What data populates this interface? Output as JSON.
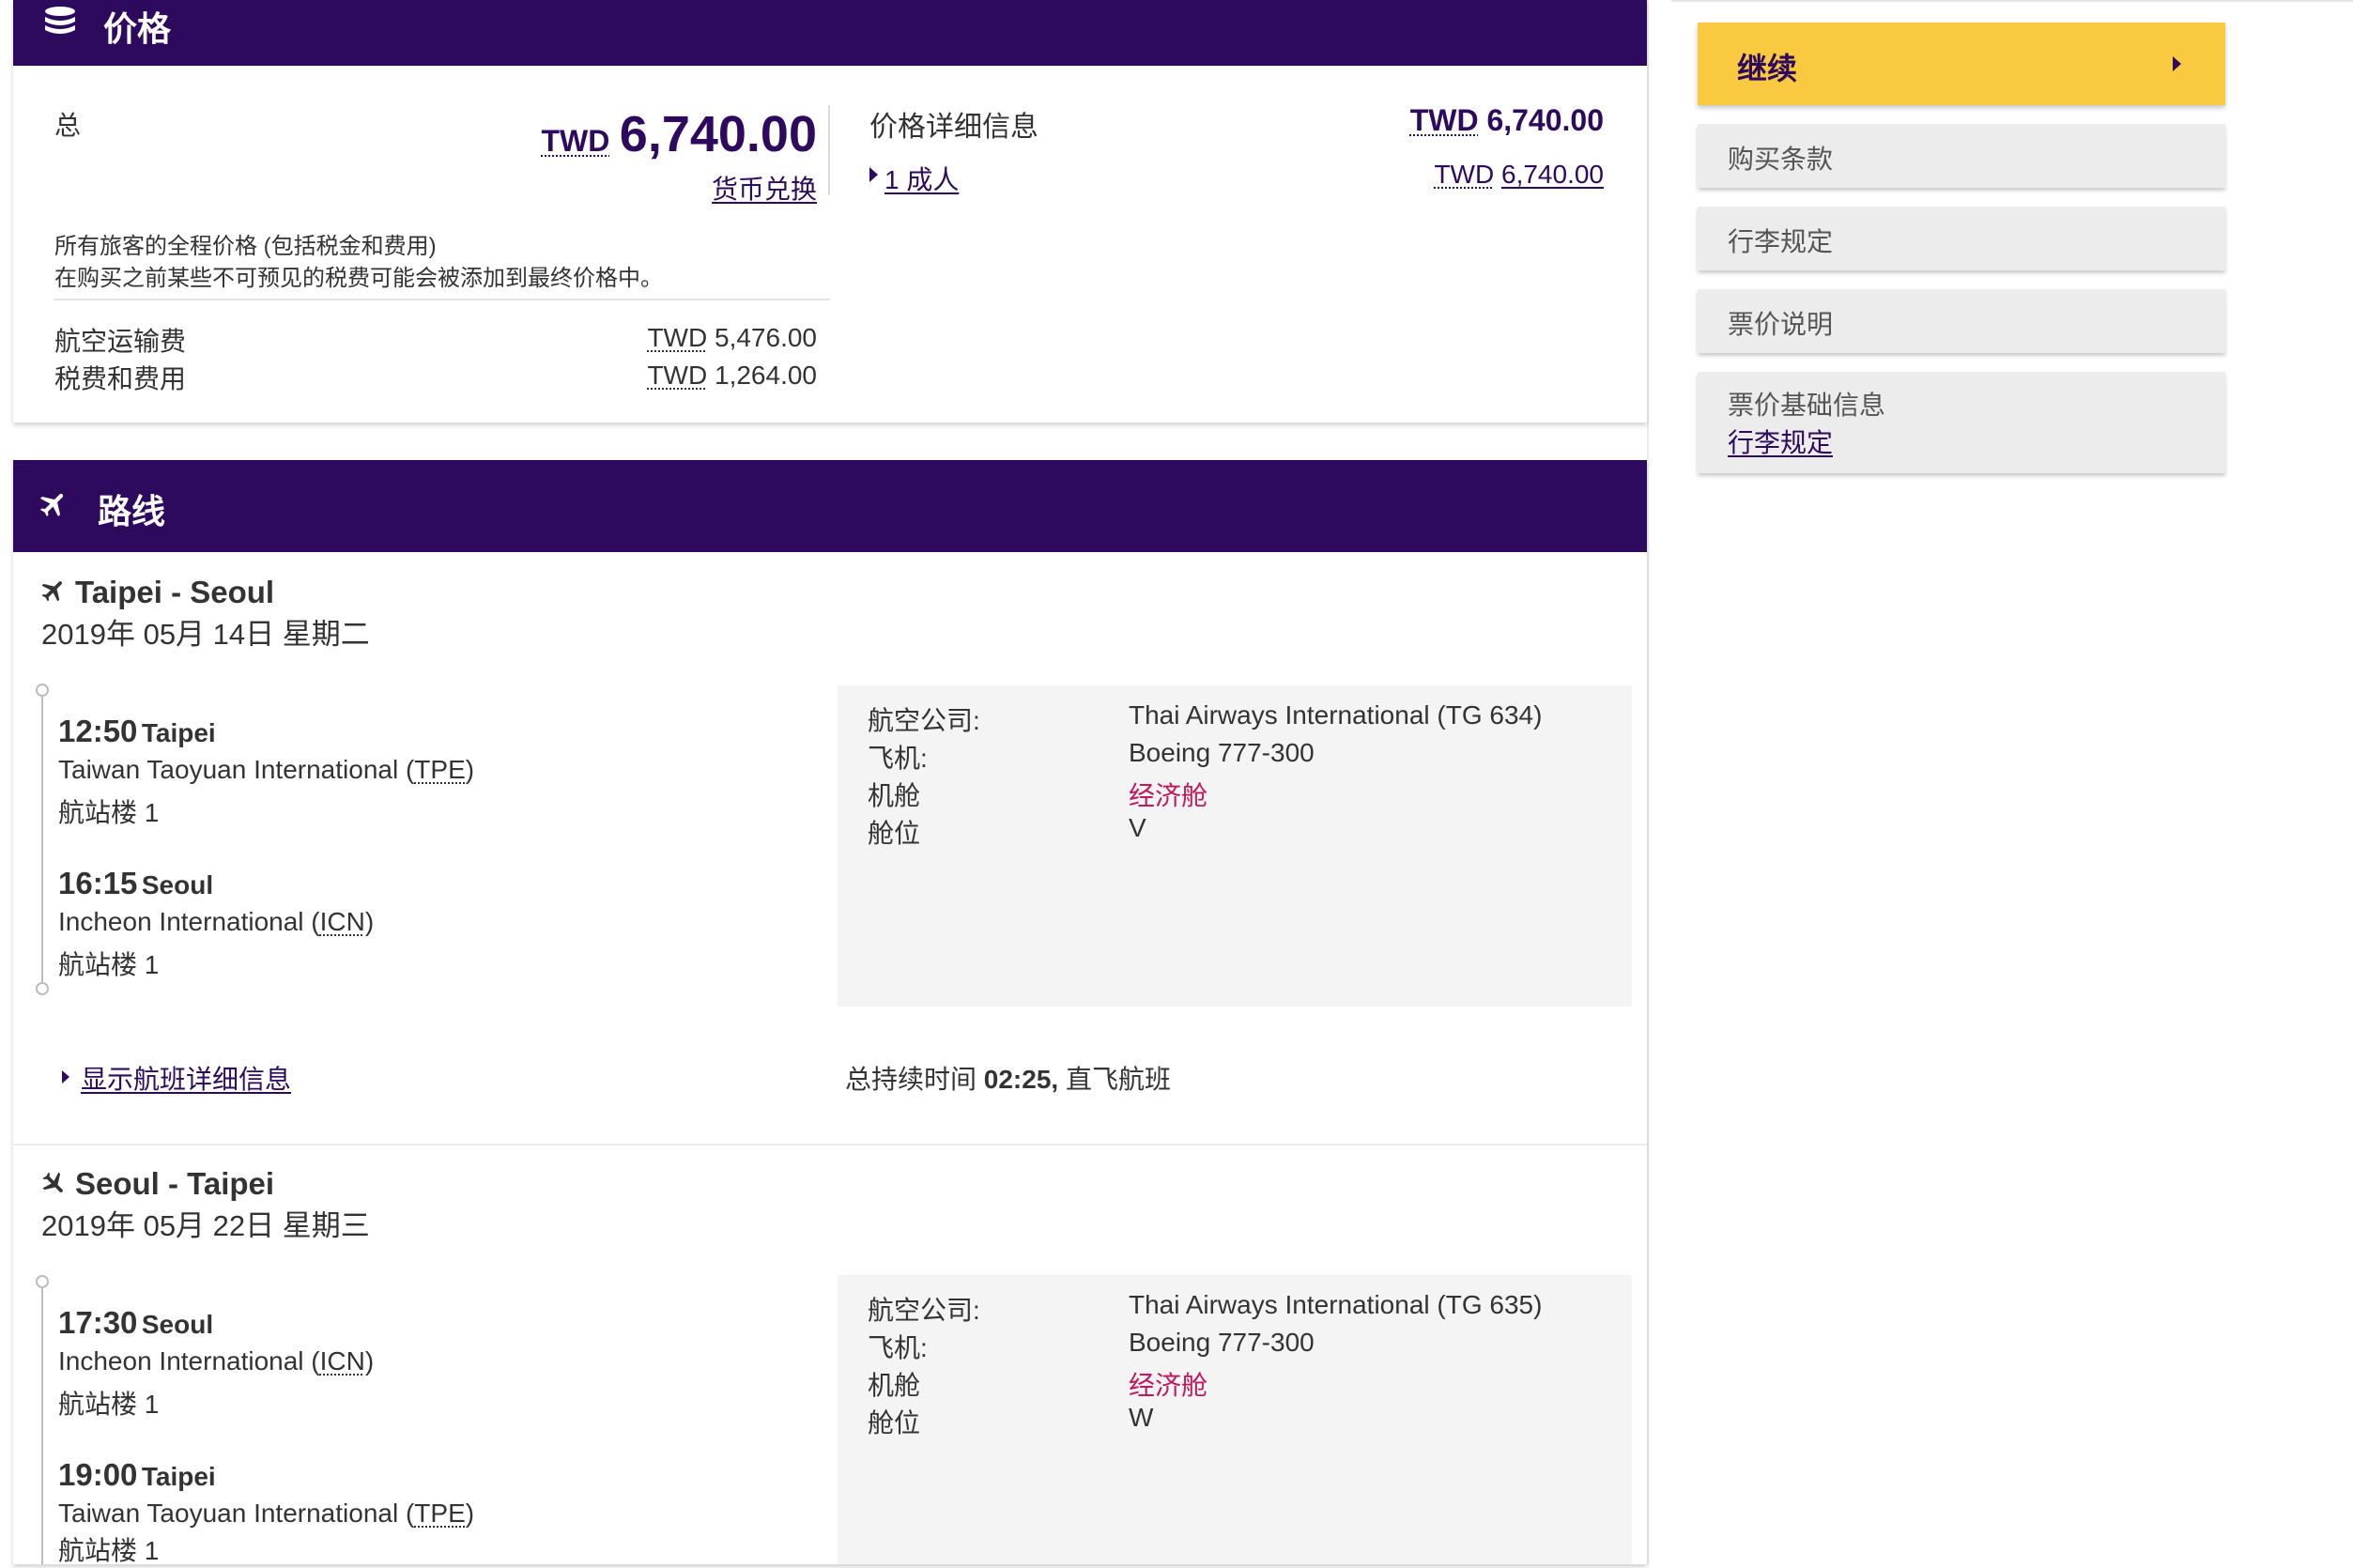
{
  "price_section": {
    "title": "价格",
    "icon": "coins-icon",
    "total_label": "总",
    "total_currency": "TWD",
    "total_amount": "6,740.00",
    "currency_convert": "货币兑换",
    "note_line1": "所有旅客的全程价格 (包括税金和费用)",
    "note_line2": "在购买之前某些不可预见的税费可能会被添加到最终价格中。",
    "fare_rows": [
      {
        "label": "航空运输费",
        "currency": "TWD",
        "amount": "5,476.00"
      },
      {
        "label": "税费和费用",
        "currency": "TWD",
        "amount": "1,264.00"
      }
    ],
    "details_title": "价格详细信息",
    "details_currency": "TWD",
    "details_amount": "6,740.00",
    "passenger_link": "1 成人",
    "passenger_currency": "TWD",
    "passenger_amount": "6,740.00"
  },
  "route_section": {
    "title": "路线",
    "icon": "plane-icon",
    "flights": [
      {
        "route": "Taipei - Seoul",
        "date": "2019年 05月 14日 星期二",
        "dep_time": "12:50",
        "dep_city": "Taipei",
        "dep_airport": "Taiwan Taoyuan International (",
        "dep_code": "TPE",
        "dep_airport_end": ")",
        "dep_terminal": "航站楼 1",
        "arr_time": "16:15",
        "arr_city": "Seoul",
        "arr_airport": "Incheon International (",
        "arr_code": "ICN",
        "arr_airport_end": ")",
        "arr_terminal": "航站楼 1",
        "airline_label": "航空公司:",
        "airline_value": "Thai Airways International (TG 634)",
        "aircraft_label": "飞机:",
        "aircraft_value": "Boeing 777-300",
        "cabin_label": "机舱",
        "cabin_value": "经济舱",
        "class_label": "舱位",
        "class_value": "V",
        "details_link": "显示航班详细信息",
        "duration_prefix": "总持续时间 ",
        "duration": "02:25,",
        "duration_suffix": " 直飞航班"
      },
      {
        "route": "Seoul - Taipei",
        "date": "2019年 05月 22日 星期三",
        "dep_time": "17:30",
        "dep_city": "Seoul",
        "dep_airport": "Incheon International (",
        "dep_code": "ICN",
        "dep_airport_end": ")",
        "dep_terminal": "航站楼 1",
        "arr_time": "19:00",
        "arr_city": "Taipei",
        "arr_airport": "Taiwan Taoyuan International (",
        "arr_code": "TPE",
        "arr_airport_end": ")",
        "arr_terminal": "航站楼 1",
        "airline_label": "航空公司:",
        "airline_value": "Thai Airways International (TG 635)",
        "aircraft_label": "飞机:",
        "aircraft_value": "Boeing 777-300",
        "cabin_label": "机舱",
        "cabin_value": "经济舱",
        "class_label": "舱位",
        "class_value": "W"
      }
    ]
  },
  "sidebar": {
    "continue_label": "继续",
    "continue_icon": "caret-right-icon",
    "purchase_terms": "购买条款",
    "baggage_rules": "行李规定",
    "fare_notes": "票价说明",
    "fare_basis_title": "票价基础信息",
    "fare_basis_link": "行李规定"
  },
  "colors": {
    "brand_purple": "#2e0a5f",
    "continue_yellow": "#f9ca3f",
    "cabin_red": "#c2185b",
    "detail_bg": "#f4f4f4"
  }
}
